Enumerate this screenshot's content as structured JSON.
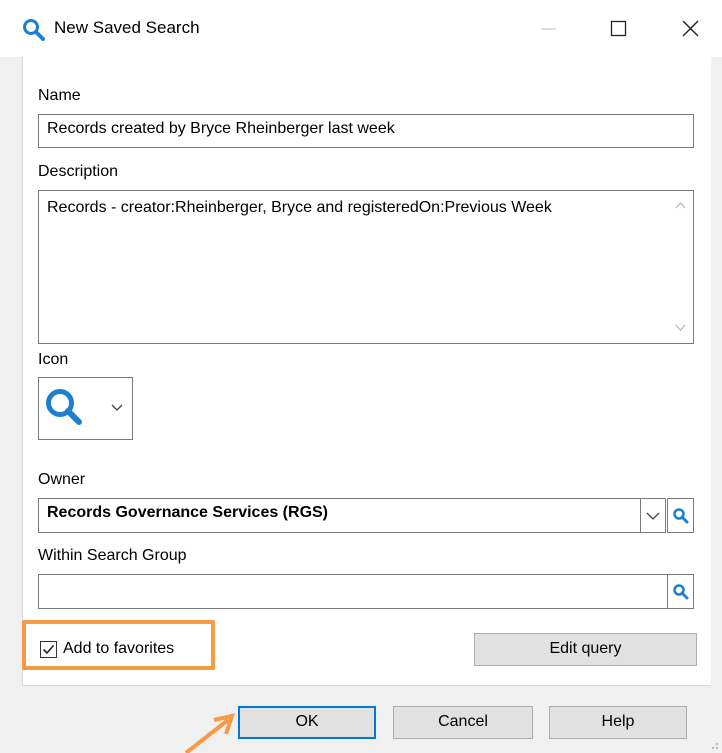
{
  "window": {
    "title": "New Saved Search",
    "icon": "search-icon"
  },
  "form": {
    "name_label": "Name",
    "name_value": "Records created by Bryce Rheinberger last week",
    "description_label": "Description",
    "description_value": "Records - creator:Rheinberger, Bryce and registeredOn:Previous Week",
    "icon_label": "Icon",
    "icon_value": "search-icon",
    "owner_label": "Owner",
    "owner_value": "Records Governance Services (RGS)",
    "group_label": "Within Search Group",
    "group_value": "",
    "favorites_label": "Add to favorites",
    "favorites_checked": true
  },
  "buttons": {
    "edit_query": "Edit query",
    "ok": "OK",
    "cancel": "Cancel",
    "help": "Help"
  },
  "colors": {
    "accent": "#0078d7",
    "icon_blue": "#1e7fd0",
    "annotation_orange": "#f79a46"
  }
}
